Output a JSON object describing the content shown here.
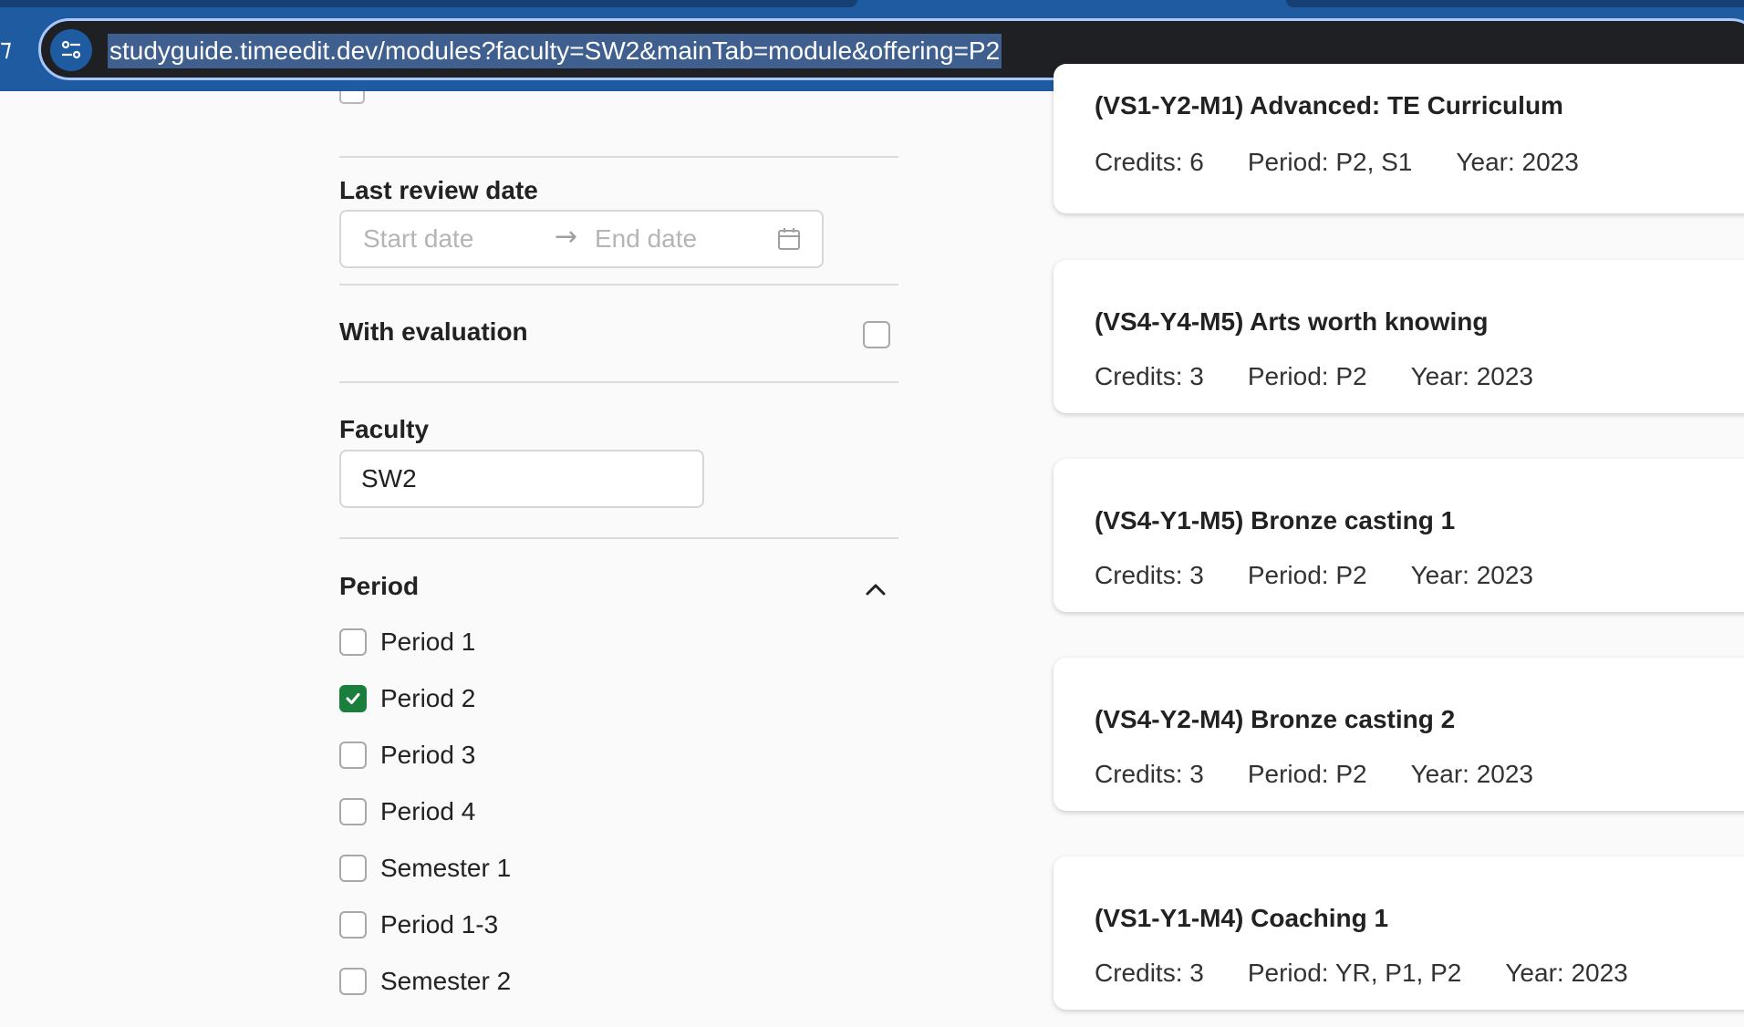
{
  "browser": {
    "url": "studyguide.timeedit.dev/modules?faculty=SW2&mainTab=module&offering=P2"
  },
  "filters": {
    "last_review_label": "Last review date",
    "start_placeholder": "Start date",
    "arrow": "→",
    "end_placeholder": "End date",
    "with_evaluation_label": "With evaluation",
    "faculty_label": "Faculty",
    "faculty_value": "SW2",
    "period_label": "Period",
    "periods": [
      {
        "label": "Period 1",
        "checked": false
      },
      {
        "label": "Period 2",
        "checked": true
      },
      {
        "label": "Period 3",
        "checked": false
      },
      {
        "label": "Period 4",
        "checked": false
      },
      {
        "label": "Semester 1",
        "checked": false
      },
      {
        "label": "Period 1-3",
        "checked": false
      },
      {
        "label": "Semester 2",
        "checked": false
      }
    ]
  },
  "modules": [
    {
      "title": "(VS1-Y2-M1) Advanced: TE Curriculum",
      "credits": "Credits: 6",
      "period": "Period: P2, S1",
      "year": "Year: 2023"
    },
    {
      "title": "(VS4-Y4-M5) Arts worth knowing",
      "credits": "Credits: 3",
      "period": "Period: P2",
      "year": "Year: 2023"
    },
    {
      "title": "(VS4-Y1-M5) Bronze casting 1",
      "credits": "Credits: 3",
      "period": "Period: P2",
      "year": "Year: 2023"
    },
    {
      "title": "(VS4-Y2-M4) Bronze casting 2",
      "credits": "Credits: 3",
      "period": "Period: P2",
      "year": "Year: 2023"
    },
    {
      "title": "(VS1-Y1-M4) Coaching 1",
      "credits": "Credits: 3",
      "period": "Period: YR, P1, P2",
      "year": "Year: 2023"
    }
  ],
  "icons": {
    "site_info": "tune-icon",
    "calendar": "calendar-icon",
    "collapse": "chevron-up-icon",
    "check": "check-icon"
  }
}
